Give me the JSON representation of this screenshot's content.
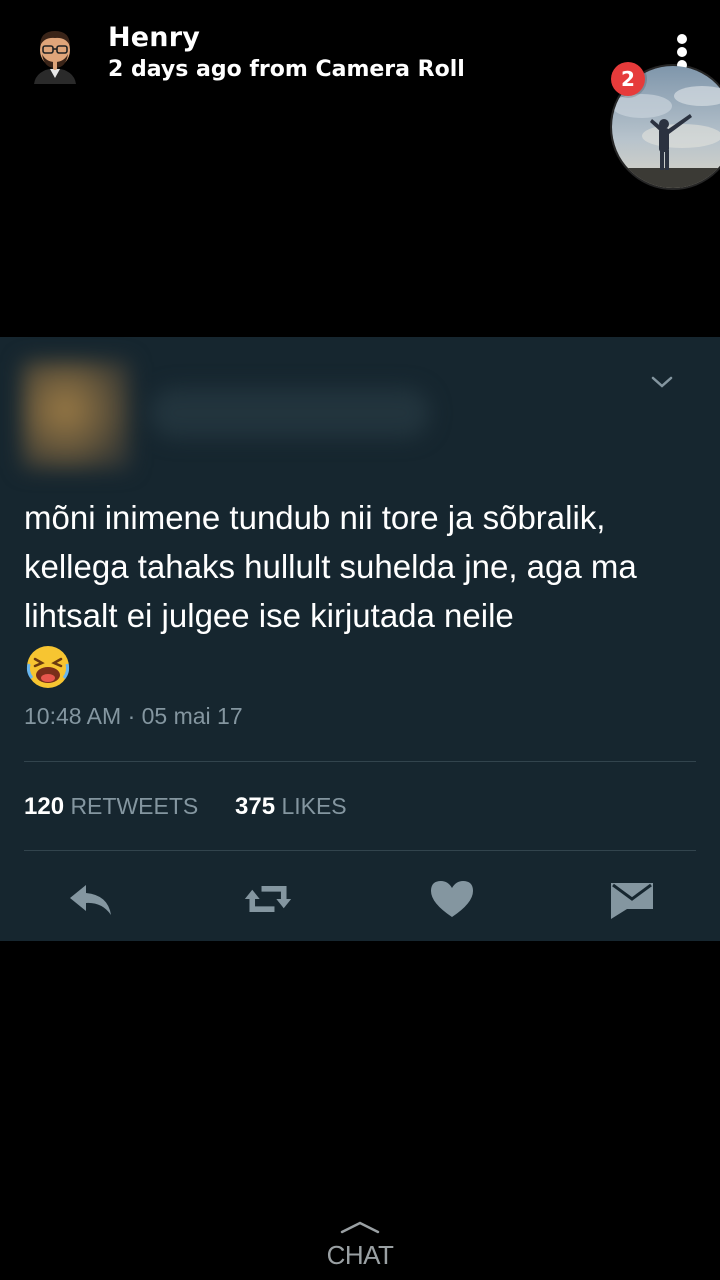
{
  "header": {
    "user_name": "Henry",
    "subtitle": "2 days ago from Camera Roll",
    "badge_count": "2"
  },
  "tweet": {
    "text": "mõni inimene tundub nii tore ja sõbralik, kellega tahaks hullult suhelda jne, aga ma lihtsalt ei julgee ise kirjutada neile",
    "timestamp": "10:48 AM · 05 mai 17",
    "retweets_count": "120",
    "retweets_label": "RETWEETS",
    "likes_count": "375",
    "likes_label": "LIKES",
    "icons": [
      "reply-icon",
      "retweet-icon",
      "like-icon",
      "direct-message-icon"
    ]
  },
  "footer": {
    "chat_label": "CHAT"
  },
  "colors": {
    "tweet_background": "#16262f",
    "muted_text": "#8496a0",
    "badge": "#e63b3b"
  }
}
